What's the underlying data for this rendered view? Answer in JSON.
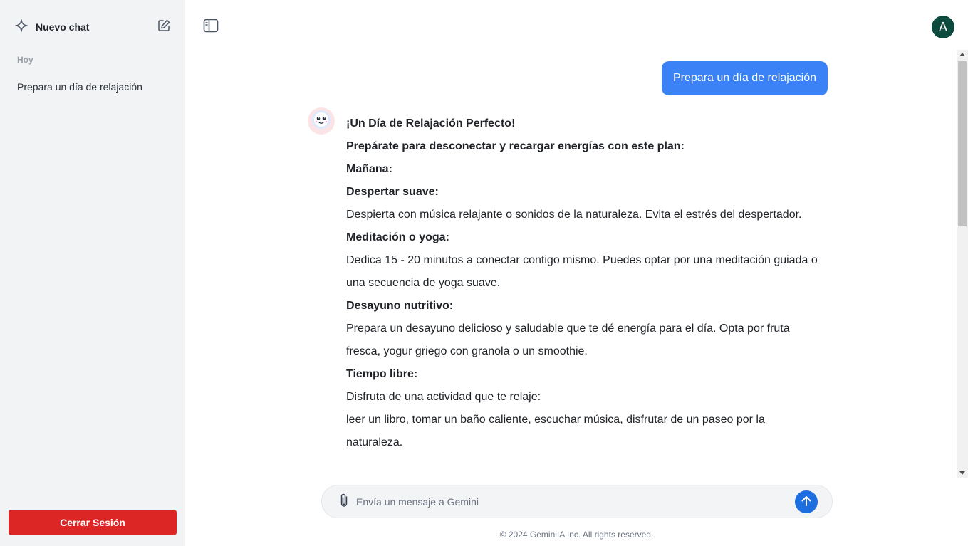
{
  "sidebar": {
    "new_chat_label": "Nuevo chat",
    "section_label": "Hoy",
    "history": [
      "Prepara un día de relajación"
    ],
    "logout_label": "Cerrar Sesión"
  },
  "header": {
    "avatar_initial": "A"
  },
  "chat": {
    "user_message": "Prepara un día de relajación",
    "bot_lines": [
      "¡Un Día de Relajación Perfecto!",
      "Prepárate para desconectar y recargar energías con este plan:",
      "Mañana:",
      "Despertar suave:",
      "Despierta con música relajante o sonidos de la naturaleza. Evita el estrés del despertador.",
      "Meditación o yoga:",
      "Dedica 15  - 20 minutos a conectar contigo mismo. Puedes optar por una meditación guiada o una secuencia de yoga suave.",
      "Desayuno nutritivo:",
      "Prepara un desayuno delicioso y saludable que te dé energía para el día. Opta por fruta fresca, yogur griego con granola o un smoothie.",
      "Tiempo libre:",
      "Disfruta de una actividad que te relaje:",
      "leer un libro, tomar un baño caliente, escuchar música, disfrutar de un paseo por la naturaleza."
    ]
  },
  "composer": {
    "placeholder": "Envía un mensaje a Gemini",
    "value": ""
  },
  "footer": {
    "text": "© 2024 GeminiIA Inc. All rights reserved."
  },
  "colors": {
    "accent": "#3b82f6",
    "send": "#1d6fe0",
    "logout": "#dc2626",
    "avatar": "#0b4a3d",
    "sidebar_bg": "#f2f3f5"
  },
  "icons": {
    "new_chat": "sparkle-icon",
    "edit": "edit-icon",
    "toggle": "sidebar-toggle-icon",
    "attach": "paperclip-icon",
    "send": "arrow-up-icon",
    "bot": "robot-icon"
  }
}
